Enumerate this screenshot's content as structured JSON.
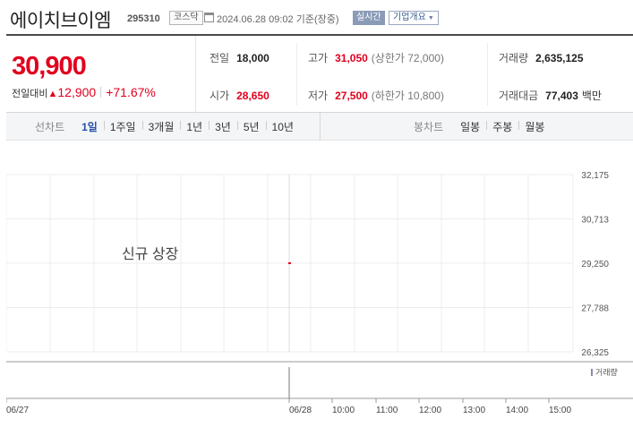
{
  "header": {
    "name": "에이치브이엠",
    "code": "295310",
    "market": "코스닥",
    "date": "2024.06.28 09:02",
    "basis": "기준(장중)",
    "realtime": "실시간",
    "overview": "기업개요"
  },
  "price": {
    "current": "30,900",
    "change_label": "전일대비",
    "change_amount": "12,900",
    "change_rate": "+71.67%",
    "direction": "up"
  },
  "stats": {
    "prev_close": {
      "label": "전일",
      "value": "18,000"
    },
    "open": {
      "label": "시가",
      "value": "28,650"
    },
    "high": {
      "label": "고가",
      "value": "31,050",
      "sub": "(상한가 72,000)"
    },
    "low": {
      "label": "저가",
      "value": "27,500",
      "sub": "(하한가 10,800)"
    },
    "volume": {
      "label": "거래량",
      "value": "2,635,125"
    },
    "amount": {
      "label": "거래대금",
      "value": "77,403",
      "unit": "백만"
    }
  },
  "period_bar": {
    "line_label": "선차트",
    "line_options": [
      "1일",
      "1주일",
      "3개월",
      "1년",
      "3년",
      "5년",
      "10년"
    ],
    "line_active": "1일",
    "candle_label": "봉차트",
    "candle_options": [
      "일봉",
      "주봉",
      "월봉"
    ]
  },
  "chart_data": {
    "type": "line",
    "annotation": "신규 상장",
    "y_ticks": [
      "32,175",
      "30,713",
      "29,250",
      "27,788",
      "26,325"
    ],
    "ylim": [
      26325,
      32175
    ],
    "x_ticks": [
      "06/27",
      "06/28",
      "10:00",
      "11:00",
      "12:00",
      "13:00",
      "14:00",
      "15:00"
    ],
    "series": [
      {
        "x": [
          "09:00"
        ],
        "values": [
          29250
        ]
      }
    ],
    "volume_label": "거래량",
    "grid": true,
    "colors": {
      "price": "#e1001e",
      "grid": "#ececec",
      "volume": "#8a8aa8"
    }
  }
}
